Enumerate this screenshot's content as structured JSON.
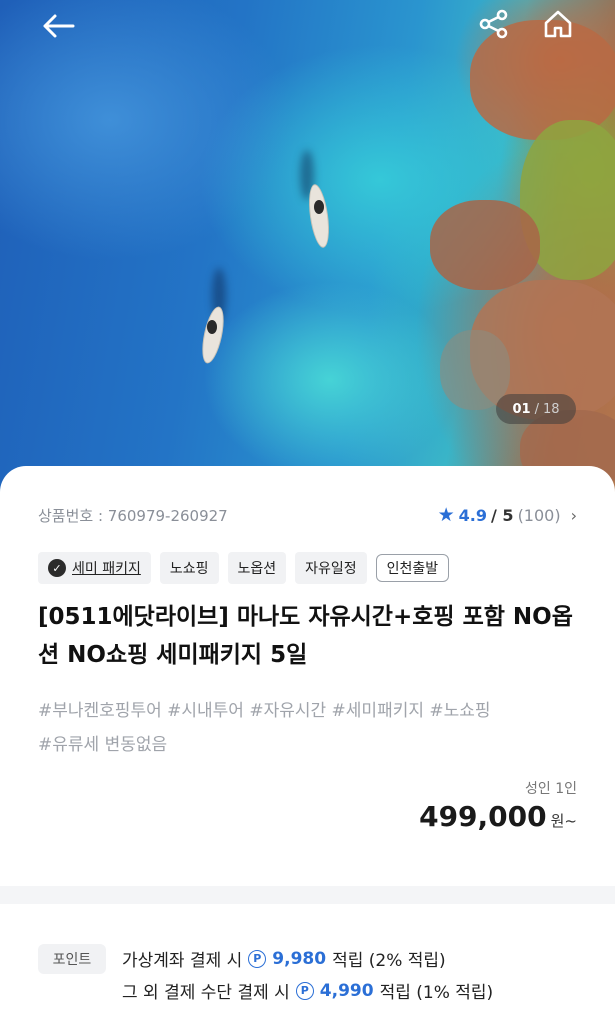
{
  "header": {
    "back_icon": "arrow-left-icon",
    "share_icon": "share-icon",
    "home_icon": "home-icon"
  },
  "gallery": {
    "current": "01",
    "separator": "/",
    "total": "18"
  },
  "product": {
    "number": "상품번호 : 760979-260927",
    "rating": {
      "score": "4.9",
      "max": "/ 5",
      "count": "(100)"
    },
    "tags": [
      {
        "label": "세미 패키지",
        "icon": "check-badge-icon"
      },
      {
        "label": "노쇼핑"
      },
      {
        "label": "노옵션"
      },
      {
        "label": "자유일정"
      },
      {
        "label": "인천출발"
      }
    ],
    "title": "[0511에닷라이브] 마나도 자유시간+호핑 포함 NO옵션 NO쇼핑 세미패키지 5일",
    "hashtags_line1": "#부나켄호핑투어 #시내투어 #자유시간 #세미패키지 #노쇼핑",
    "hashtags_line2": "#유류세 변동없음",
    "price_label": "성인 1인",
    "price_amount": "499,000",
    "price_unit": "원~"
  },
  "points": {
    "badge": "포인트",
    "line1": {
      "text": "가상계좌 결제 시",
      "icon": "P",
      "amount": "9,980",
      "suffix": "적립 (2% 적립)"
    },
    "line2": {
      "text": "그 외 결제 수단 결제 시",
      "icon": "P",
      "amount": "4,990",
      "suffix": "적립 (1% 적립)"
    }
  },
  "colors": {
    "accent": "#2b6fd6",
    "muted": "#8a8f98"
  }
}
